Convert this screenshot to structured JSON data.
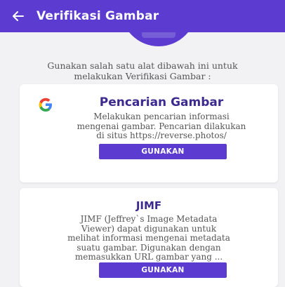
{
  "app_bar": {
    "title": "Verifikasi Gambar",
    "back_icon": "arrow-left-icon",
    "color": "#5b3bd0"
  },
  "intro": {
    "line1": "Gunakan salah satu alat dibawah ini untuk",
    "line2": "melakukan Verifikasi Gambar :"
  },
  "tools": [
    {
      "icon": "google-icon",
      "title": "Pencarian Gambar",
      "description_lines": [
        "Melakukan pencarian informasi",
        "mengenai gambar. Pencarian dilakukan",
        "di situs https://reverse.photos/"
      ],
      "button_label": "GUNAKAN"
    },
    {
      "title": "JIMF",
      "description_lines": [
        "JIMF (Jeffrey`s Image Metadata",
        "Viewer) dapat digunakan untuk",
        "melihat informasi mengenai metadata",
        "suatu gambar. Digunakan dengan",
        "memasukkan URL gambar yang ..."
      ],
      "button_label": "GUNAKAN"
    }
  ],
  "colors": {
    "primary": "#5b3bd0",
    "title_text": "#3d2a8f",
    "background": "#f2f1f4"
  }
}
